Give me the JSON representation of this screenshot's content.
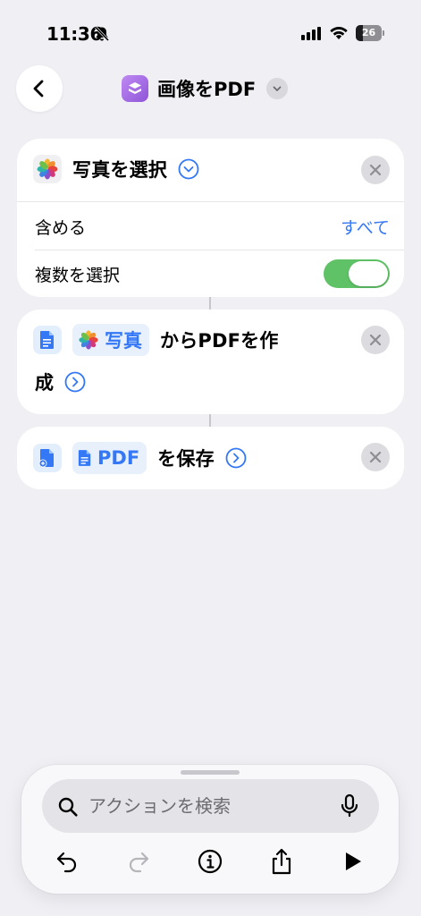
{
  "status_bar": {
    "time": "11:36",
    "battery_level": "26",
    "icons": [
      "bell-slash-icon",
      "cellular-signal-icon",
      "wifi-icon",
      "battery-icon"
    ]
  },
  "nav": {
    "back_icon": "chevron-left-icon",
    "title": "画像をPDF",
    "app_icon": "shortcuts-stack-icon",
    "menu_icon": "chevron-down-icon"
  },
  "actions": {
    "select_photos": {
      "icon": "photos-icon",
      "title": "写真を選択",
      "options": [
        {
          "label": "含める",
          "value": "すべて"
        },
        {
          "label": "複数を選択",
          "toggle_on": true
        }
      ]
    },
    "make_pdf": {
      "icon": "document-icon",
      "token_icon": "photos-icon",
      "token": "写真",
      "text_line1": "からPDFを作",
      "text_line2": "成"
    },
    "save_file": {
      "icon": "document-save-icon",
      "token_icon": "document-icon",
      "token": "PDF",
      "text": "を保存"
    }
  },
  "bottom_bar": {
    "search_placeholder": "アクションを検索",
    "tools": [
      "undo-icon",
      "redo-icon",
      "info-icon",
      "share-icon",
      "play-icon"
    ]
  },
  "colors": {
    "accent": "#3478f6",
    "toggle_on": "#5fc266",
    "background": "#efeff4",
    "app_icon_purple": "#a36be6"
  }
}
